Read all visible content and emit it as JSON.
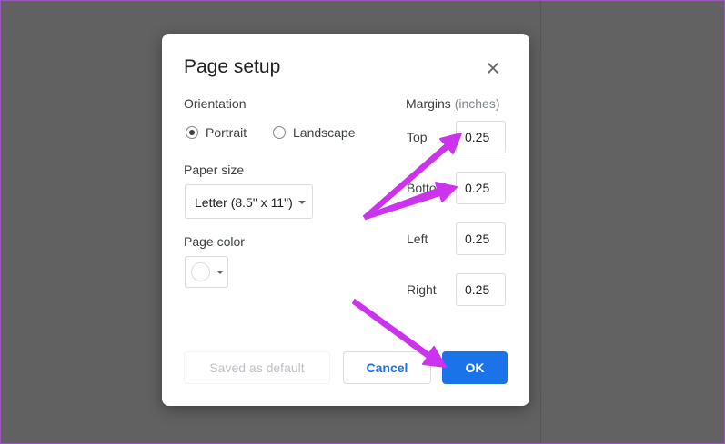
{
  "dialog": {
    "title": "Page setup",
    "orientation": {
      "label": "Orientation",
      "options": [
        {
          "label": "Portrait",
          "selected": true
        },
        {
          "label": "Landscape",
          "selected": false
        }
      ]
    },
    "paper_size": {
      "label": "Paper size",
      "value": "Letter (8.5\" x 11\")"
    },
    "page_color": {
      "label": "Page color",
      "value": "#ffffff"
    },
    "margins": {
      "label": "Margins",
      "unit": "(inches)",
      "fields": [
        {
          "label": "Top",
          "value": "0.25"
        },
        {
          "label": "Bottom",
          "value": "0.25"
        },
        {
          "label": "Left",
          "value": "0.25"
        },
        {
          "label": "Right",
          "value": "0.25"
        }
      ]
    },
    "buttons": {
      "set_default": "Saved as default",
      "cancel": "Cancel",
      "ok": "OK"
    }
  },
  "colors": {
    "accent": "#1a73e8",
    "annotation_arrow": "#cc33ee",
    "backdrop": "#616161"
  }
}
